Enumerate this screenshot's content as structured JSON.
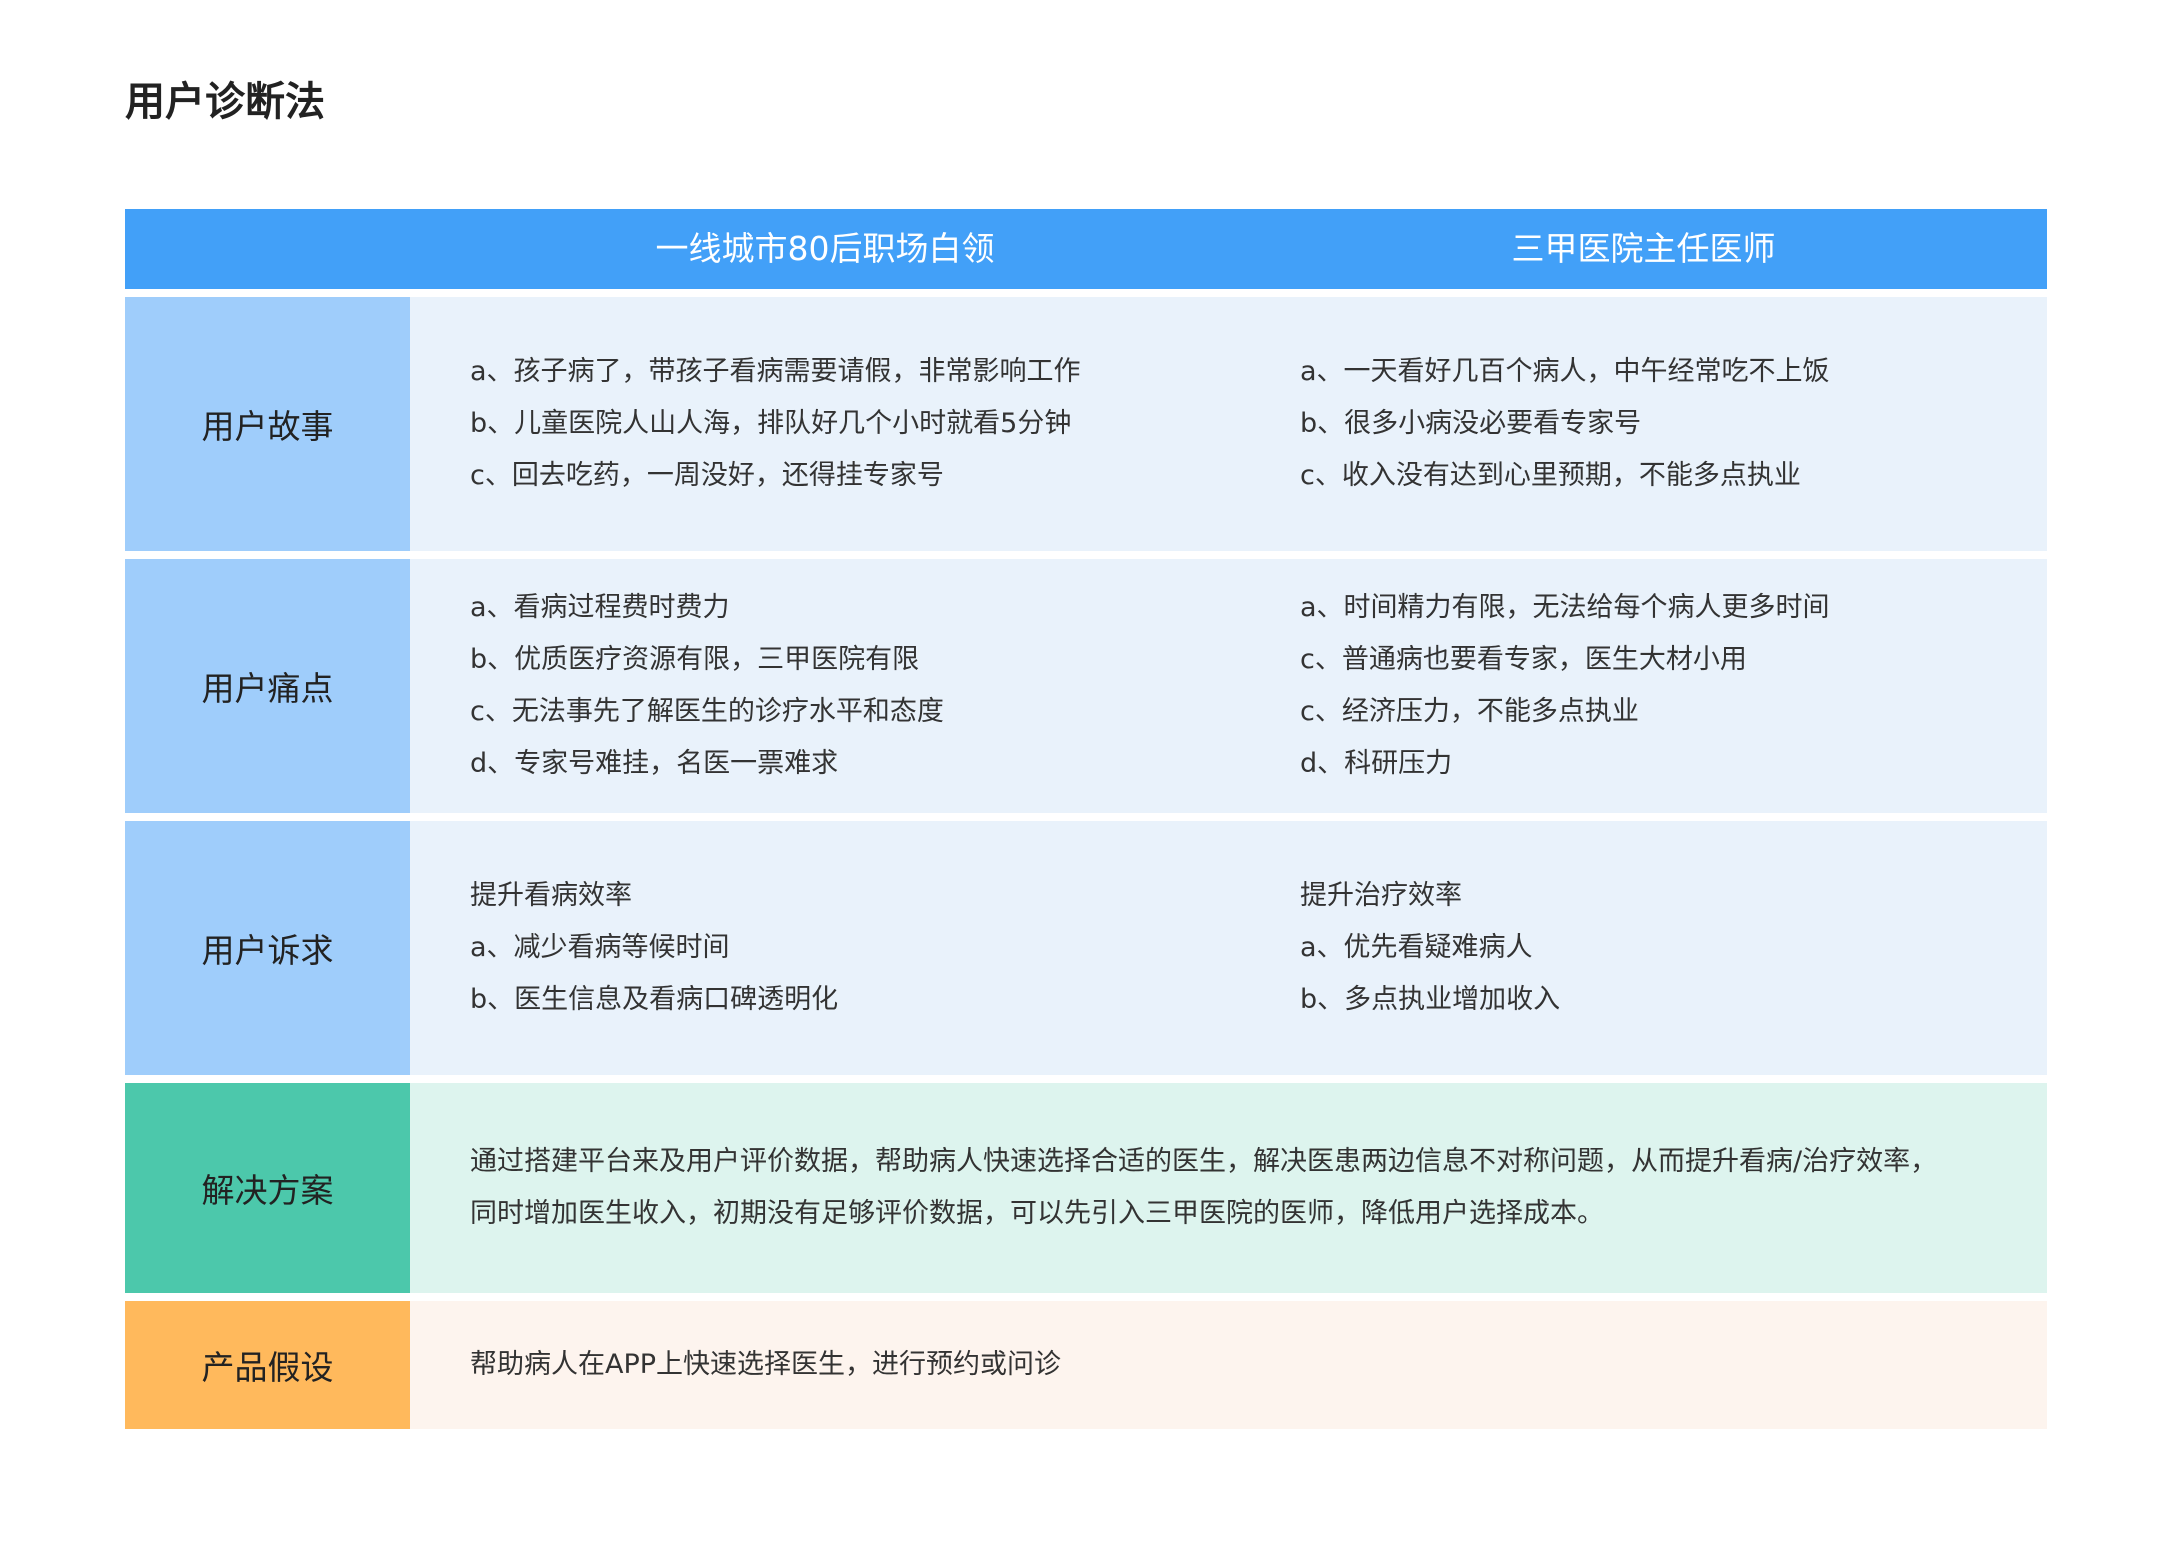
{
  "title": "用户诊断法",
  "header": {
    "col1": "一线城市80后职场白领",
    "col2": "三甲医院主任医师"
  },
  "rows": {
    "story": {
      "label": "用户故事",
      "col1": [
        "a、孩子病了，带孩子看病需要请假，非常影响工作",
        "b、儿童医院人山人海，排队好几个小时就看5分钟",
        "c、回去吃药，一周没好，还得挂专家号"
      ],
      "col2": [
        "a、一天看好几百个病人，中午经常吃不上饭",
        "b、很多小病没必要看专家号",
        "c、收入没有达到心里预期，不能多点执业"
      ]
    },
    "pain": {
      "label": "用户痛点",
      "col1": [
        "a、看病过程费时费力",
        "b、优质医疗资源有限，三甲医院有限",
        "c、无法事先了解医生的诊疗水平和态度",
        "d、专家号难挂，名医一票难求"
      ],
      "col2": [
        "a、时间精力有限，无法给每个病人更多时间",
        "c、普通病也要看专家，医生大材小用",
        "c、经济压力，不能多点执业",
        "d、科研压力"
      ]
    },
    "needs": {
      "label": "用户诉求",
      "col1": [
        "提升看病效率",
        "a、减少看病等候时间",
        "b、医生信息及看病口碑透明化"
      ],
      "col2": [
        "提升治疗效率",
        "a、优先看疑难病人",
        "b、多点执业增加收入"
      ]
    },
    "solution": {
      "label": "解决方案",
      "lines": [
        "通过搭建平台来及用户评价数据，帮助病人快速选择合适的医生，解决医患两边信息不对称问题，从而提升看病/治疗效率，",
        "同时增加医生收入，初期没有足够评价数据，可以先引入三甲医院的医师，降低用户选择成本。"
      ]
    },
    "hypothesis": {
      "label": "产品假设",
      "lines": [
        "帮助病人在APP上快速选择医生，进行预约或问诊"
      ]
    }
  },
  "colors": {
    "header": "#42a0f8",
    "label_blue": "#9fcdfb",
    "content_blue": "#e9f2fb",
    "label_green": "#4cc8ab",
    "content_green": "#ddf4ee",
    "label_orange": "#ffb95c",
    "content_orange": "#fdf4ee"
  }
}
